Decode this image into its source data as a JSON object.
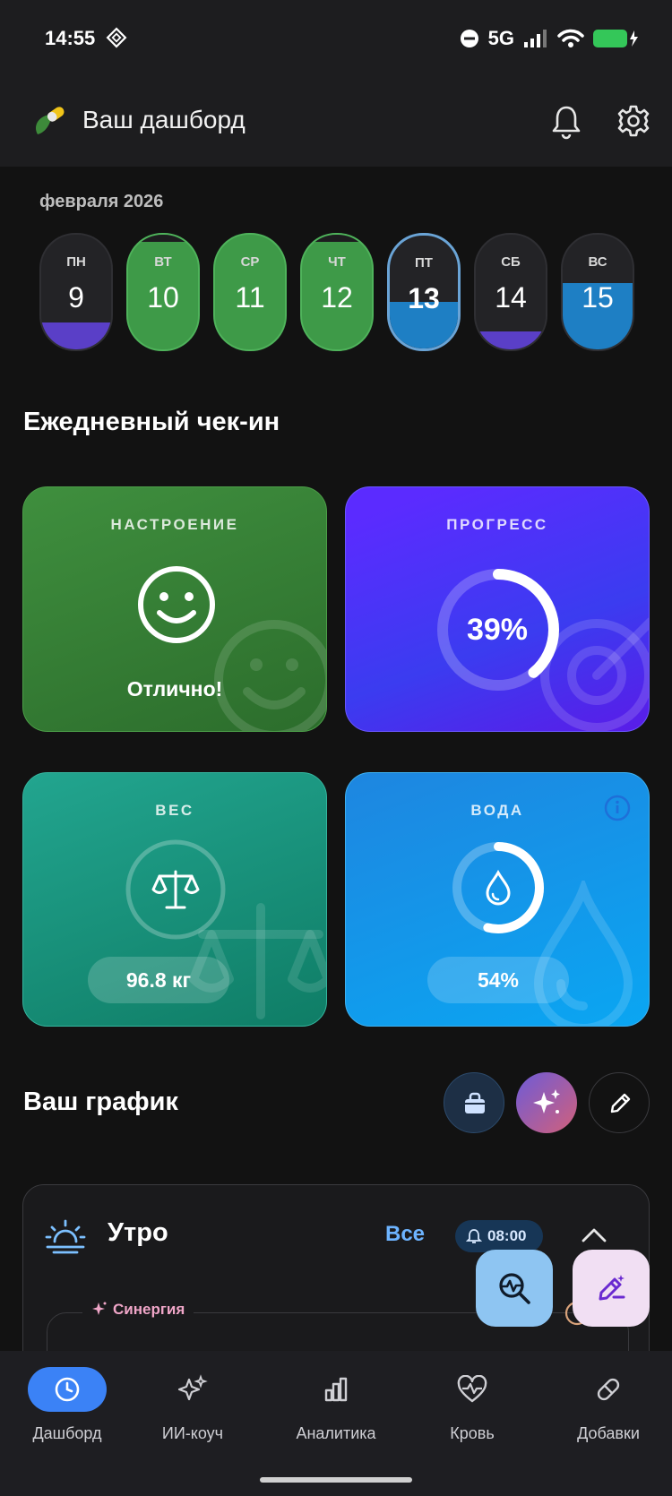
{
  "status_bar": {
    "time": "14:55",
    "network": "5G"
  },
  "header": {
    "title": "Ваш дашборд"
  },
  "calendar": {
    "month_label": "февраля 2026",
    "days": [
      {
        "name": "ПН",
        "number": "9"
      },
      {
        "name": "ВТ",
        "number": "10"
      },
      {
        "name": "СР",
        "number": "11"
      },
      {
        "name": "ЧТ",
        "number": "12"
      },
      {
        "name": "ПТ",
        "number": "13"
      },
      {
        "name": "СБ",
        "number": "14"
      },
      {
        "name": "ВС",
        "number": "15"
      }
    ],
    "selected_day": "13"
  },
  "checkin": {
    "title": "Ежедневный чек-ин",
    "mood": {
      "label": "НАСТРОЕНИЕ",
      "value": "Отлично!"
    },
    "progress": {
      "label": "ПРОГРЕСС",
      "value": "39%",
      "fraction": 0.39
    },
    "weight": {
      "label": "ВЕС",
      "value": "96.8 кг"
    },
    "water": {
      "label": "ВОДА",
      "value": "54%",
      "fraction": 0.54
    }
  },
  "schedule": {
    "title": "Ваш график",
    "morning": {
      "title": "Утро",
      "all_label": "Все",
      "alarm": "08:00"
    },
    "synergy_label": "Синергия"
  },
  "bottom_nav": {
    "items": [
      {
        "label": "Дашборд"
      },
      {
        "label": "ИИ-коуч"
      },
      {
        "label": "Аналитика"
      },
      {
        "label": "Кровь"
      },
      {
        "label": "Добавки"
      }
    ]
  },
  "colors": {
    "accent": "#3b82f6",
    "mood_card": "#3a873a",
    "progress_card": "#4b30ff",
    "weight_card": "#1a9680",
    "water_card": "#1797ec"
  }
}
